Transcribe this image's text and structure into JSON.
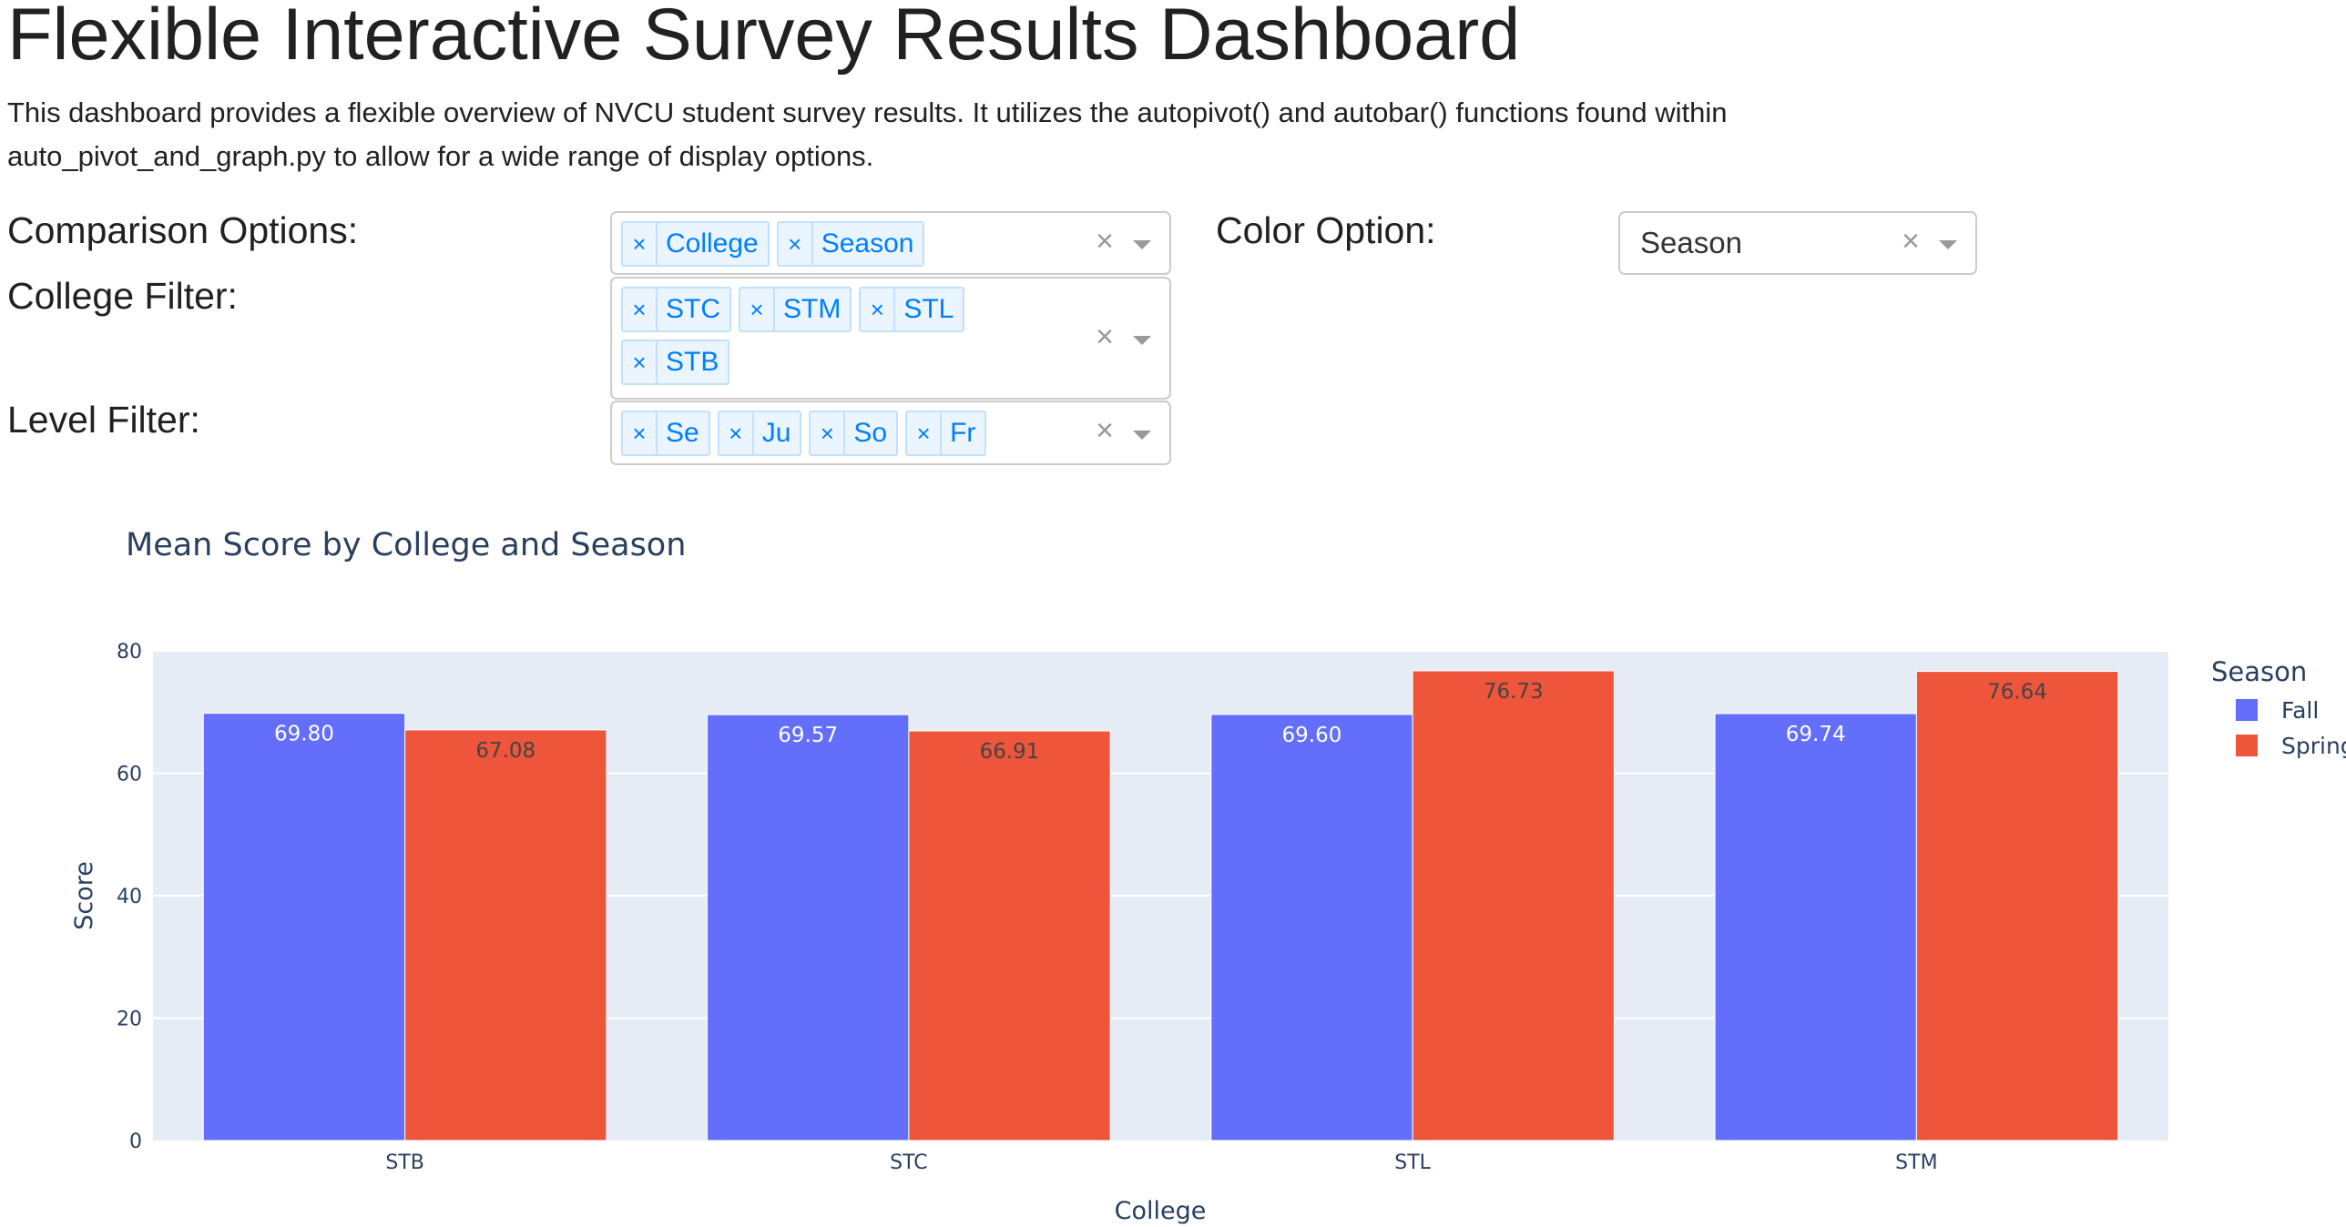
{
  "page": {
    "title": "Flexible Interactive Survey Results Dashboard",
    "description": "This dashboard provides a flexible overview of NVCU student survey results. It utilizes the autopivot() and autobar() functions found within auto_pivot_and_graph.py to allow for a wide range of display options."
  },
  "controls": {
    "comparison": {
      "label": "Comparison Options:",
      "values": [
        "College",
        "Season"
      ]
    },
    "college_filter": {
      "label": "College Filter:",
      "values": [
        "STC",
        "STM",
        "STL",
        "STB"
      ]
    },
    "level_filter": {
      "label": "Level Filter:",
      "values": [
        "Se",
        "Ju",
        "So",
        "Fr"
      ]
    },
    "color": {
      "label": "Color Option:",
      "value": "Season"
    },
    "clear_glyph": "×",
    "remove_glyph": "×"
  },
  "icons": {
    "remove": "close-icon",
    "clear": "clear-icon",
    "dropdown": "chevron-down-icon"
  },
  "chart_data": {
    "type": "bar",
    "title": "Mean Score by College and Season",
    "xlabel": "College",
    "ylabel": "Score",
    "categories": [
      "STB",
      "STC",
      "STL",
      "STM"
    ],
    "series": [
      {
        "name": "Fall",
        "values": [
          69.8,
          69.57,
          69.6,
          69.74
        ],
        "labels": [
          "69.80",
          "69.57",
          "69.60",
          "69.74"
        ],
        "color": "#636efa",
        "label_color": "#ffffff"
      },
      {
        "name": "Spring",
        "values": [
          67.08,
          66.91,
          76.73,
          76.64
        ],
        "labels": [
          "67.08",
          "66.91",
          "76.73",
          "76.64"
        ],
        "color": "#ef553b",
        "label_color": "#444444"
      }
    ],
    "ylim": [
      0,
      80
    ],
    "yticks": [
      0,
      20,
      40,
      60,
      80
    ],
    "grid": true,
    "legend": {
      "title": "Season",
      "placement": "top-right"
    },
    "colors": {
      "plot_bg": "#e5ecf6",
      "grid": "#ffffff",
      "axis_text": "#2a3f5f"
    }
  }
}
